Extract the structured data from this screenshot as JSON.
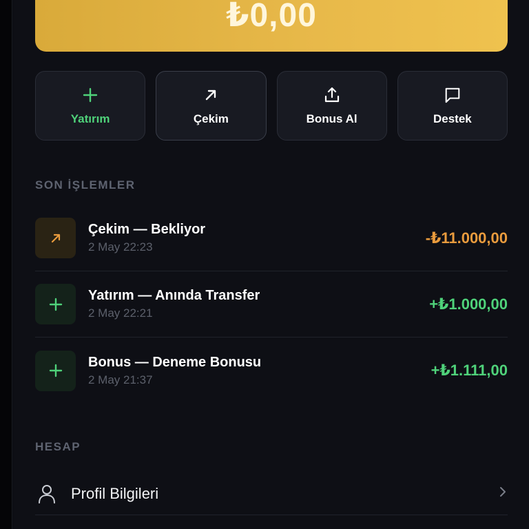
{
  "balance": {
    "amount": "₺0,00"
  },
  "actions": [
    {
      "label": "Yatırım",
      "icon": "plus-icon"
    },
    {
      "label": "Çekim",
      "icon": "arrow-up-right-icon"
    },
    {
      "label": "Bonus Al",
      "icon": "upload-icon"
    },
    {
      "label": "Destek",
      "icon": "chat-bubble-icon"
    }
  ],
  "transactions_section": {
    "title": "SON İŞLEMLER"
  },
  "transactions": [
    {
      "title": "Çekim — Bekliyor",
      "date": "2 May 22:23",
      "amount": "-₺11.000,00",
      "icon": "arrow-up-right-icon",
      "status_color": "#e99b3d"
    },
    {
      "title": "Yatırım — Anında Transfer",
      "date": "2 May 22:21",
      "amount": "+₺1.000,00",
      "icon": "plus-icon",
      "status_color": "#4fd27a"
    },
    {
      "title": "Bonus — Deneme Bonusu",
      "date": "2 May 21:37",
      "amount": "+₺1.111,00",
      "icon": "plus-icon",
      "status_color": "#4fd27a"
    }
  ],
  "account_section": {
    "title": "HESAP"
  },
  "account_menu": [
    {
      "label": "Profil Bilgileri",
      "icon": "user-icon"
    }
  ],
  "colors": {
    "accent": "#e8b94a",
    "positive": "#4fd27a",
    "negative": "#e99b3d"
  }
}
